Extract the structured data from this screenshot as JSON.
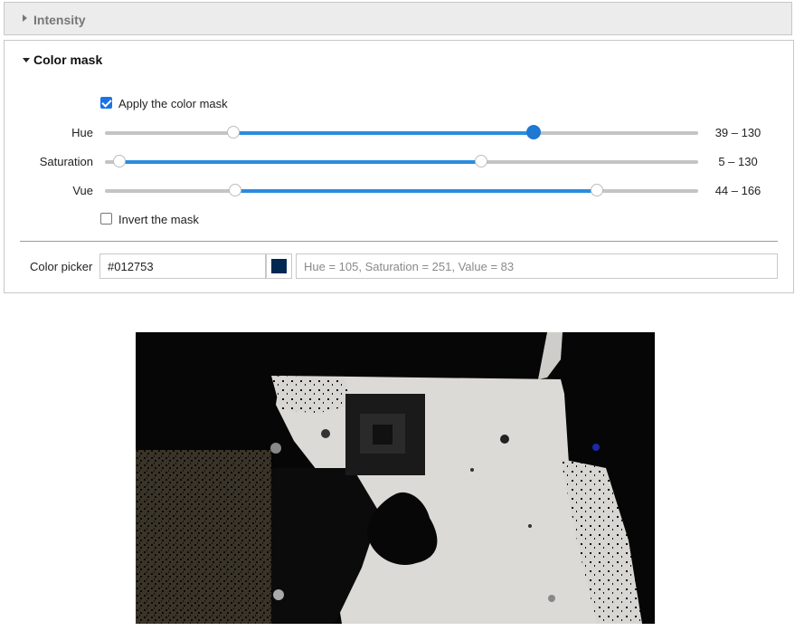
{
  "intensity": {
    "title": "Intensity"
  },
  "color_mask": {
    "title": "Color mask",
    "apply_label": "Apply the color mask",
    "apply_checked": true,
    "invert_label": "Invert the mask",
    "invert_checked": false,
    "sliders": [
      {
        "label": "Hue",
        "low": 39,
        "high": 130,
        "min": 0,
        "max": 180,
        "value_text": "39 – 130"
      },
      {
        "label": "Saturation",
        "low": 5,
        "high": 130,
        "min": 0,
        "max": 205,
        "value_text": "5 – 130"
      },
      {
        "label": "Vue",
        "low": 44,
        "high": 166,
        "min": 0,
        "max": 200,
        "value_text": "44 – 166"
      }
    ],
    "color_picker": {
      "label": "Color picker",
      "value": "#012753",
      "swatch_color": "#012753",
      "info": "Hue = 105, Saturation = 251, Value = 83"
    }
  },
  "colors": {
    "accent": "#2a8de0",
    "active_thumb": "#1f78d1"
  }
}
